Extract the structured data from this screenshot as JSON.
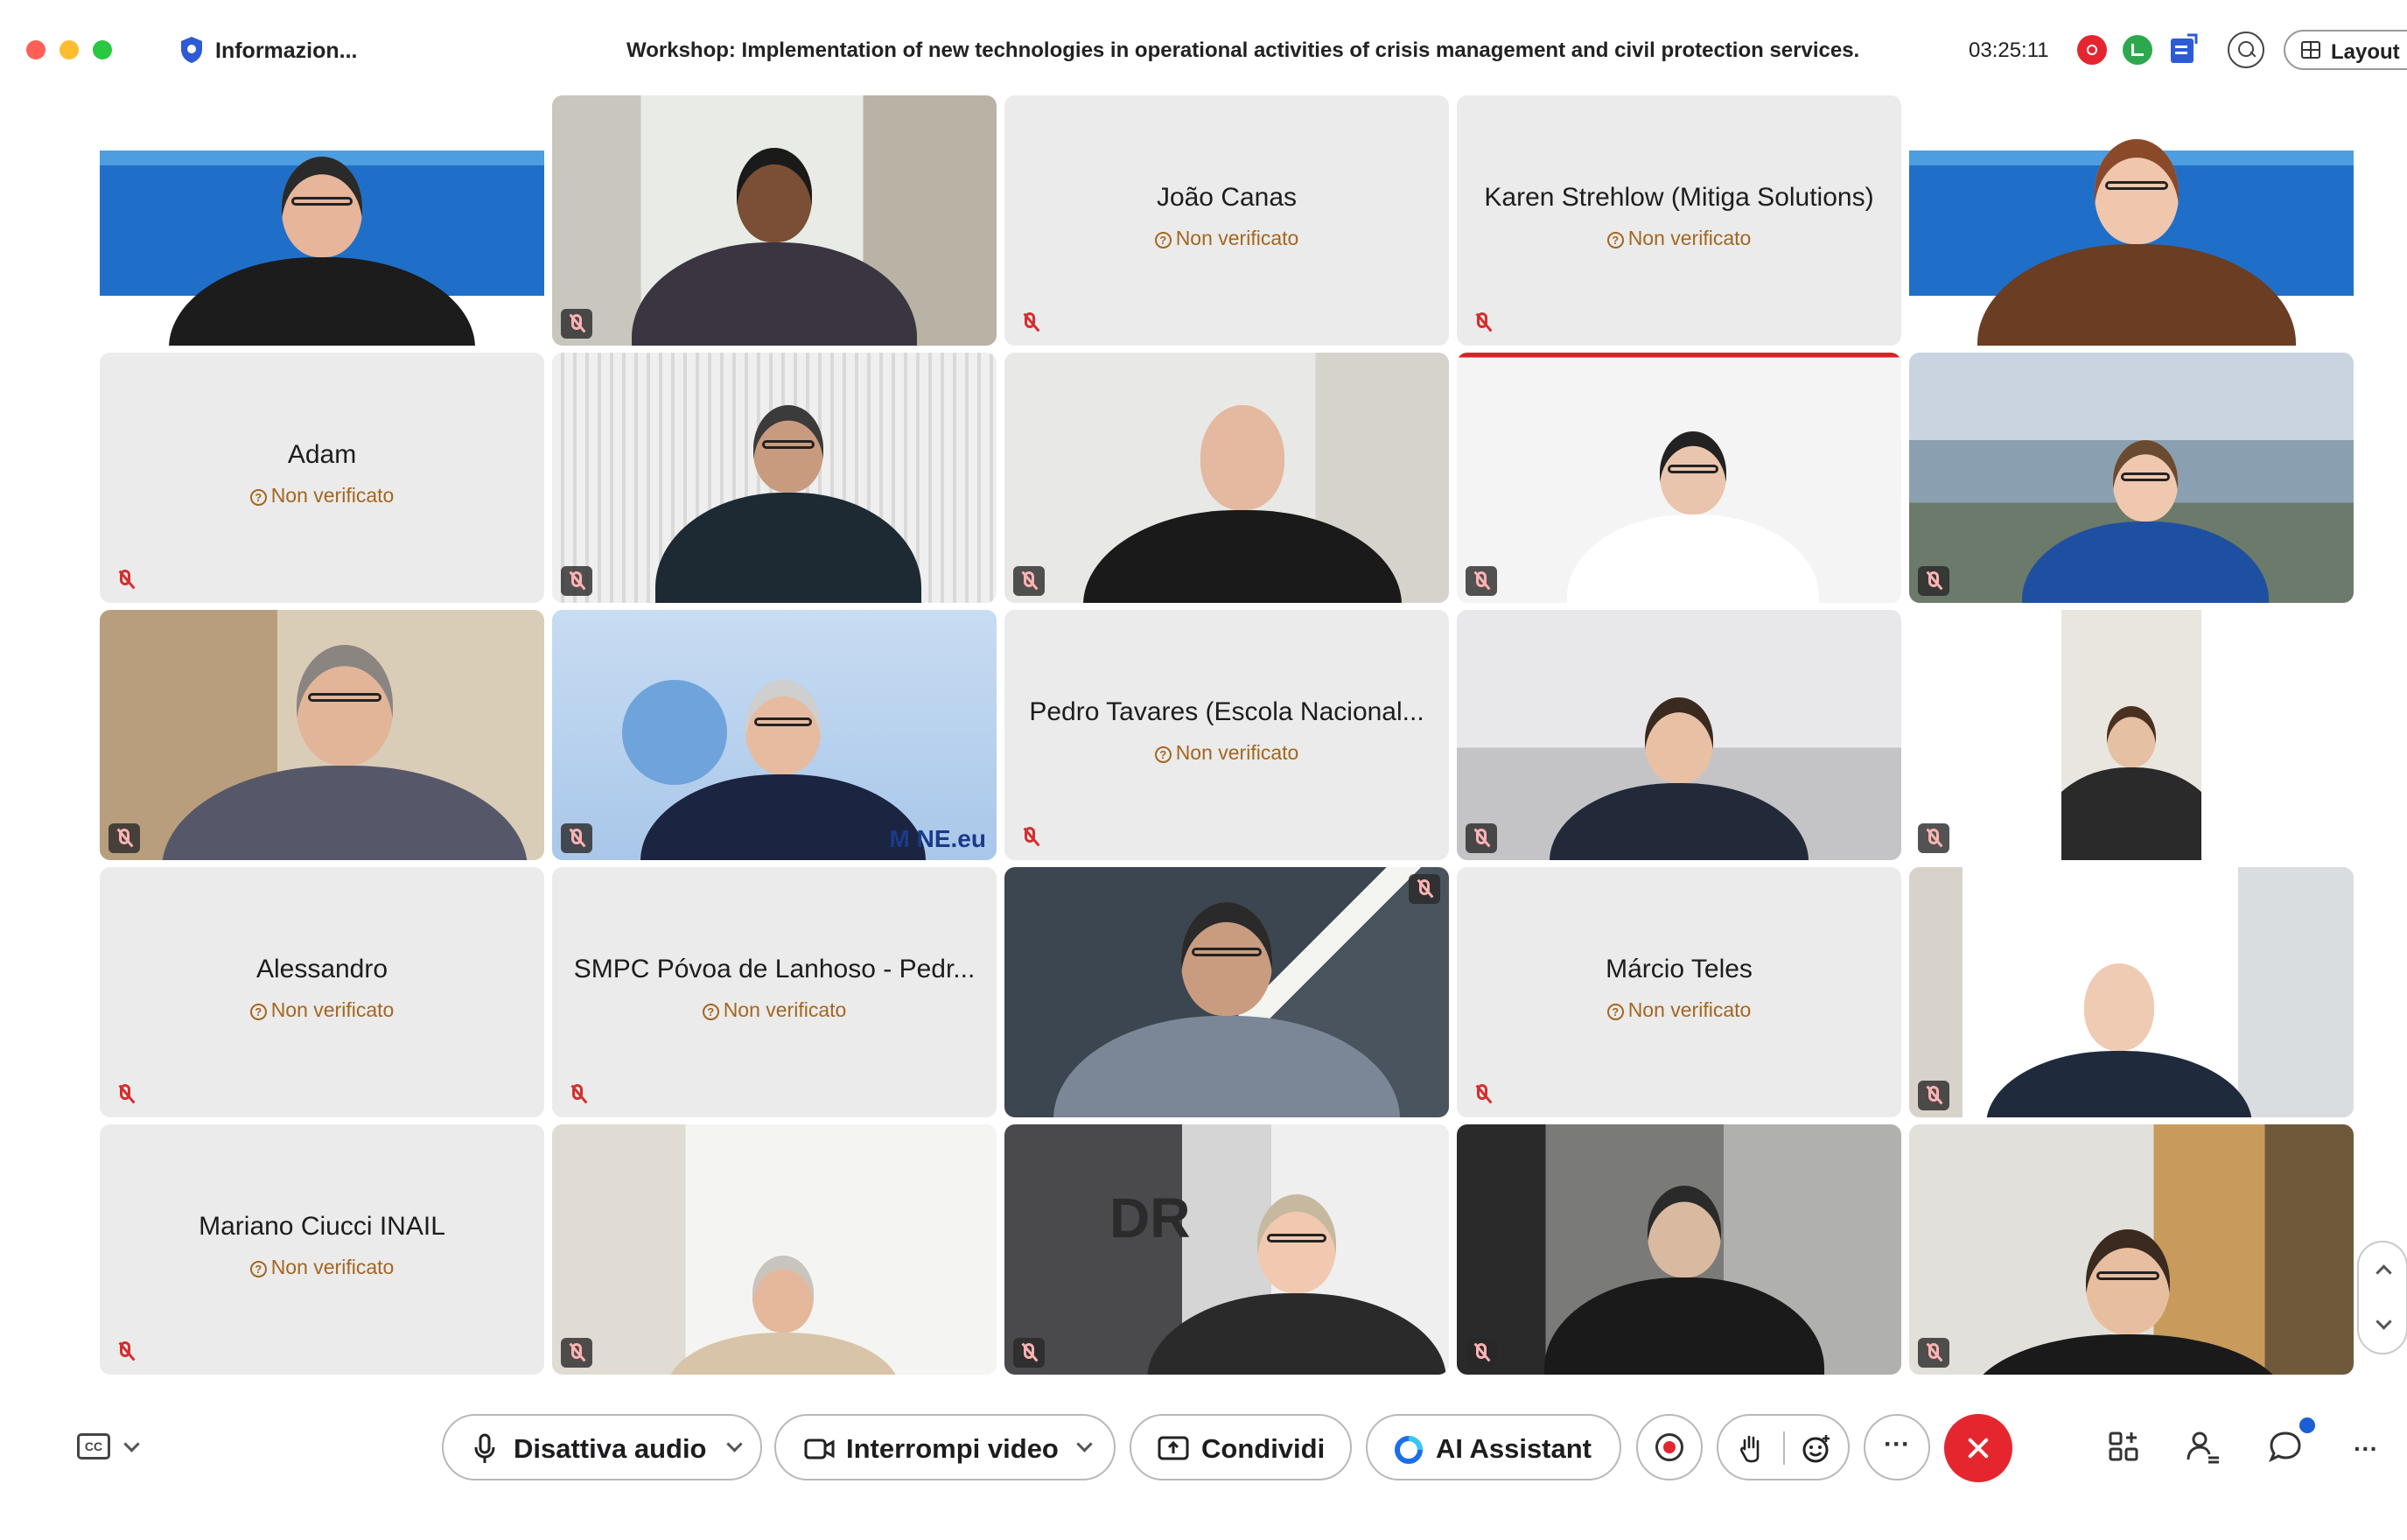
{
  "window": {
    "info_title": "Informazion...",
    "meeting_title": "Workshop: Implementation of new technologies in operational activities of crisis management and civil protection services.",
    "timer": "03:25:11",
    "layout_label": "Layout"
  },
  "tiles": [
    {
      "type": "video",
      "scene": "banner-left"
    },
    {
      "type": "video",
      "scene": "office-window"
    },
    {
      "type": "placeholder",
      "name": "João Canas",
      "status": "Non verificato"
    },
    {
      "type": "placeholder",
      "name": "Karen Strehlow (Mitiga Solutions)",
      "status": "Non verificato"
    },
    {
      "type": "video",
      "scene": "banner-right"
    },
    {
      "type": "placeholder",
      "name": "Adam",
      "status": "Non verificato"
    },
    {
      "type": "video",
      "scene": "blinds"
    },
    {
      "type": "video",
      "scene": "office-art"
    },
    {
      "type": "video",
      "scene": "red-cross"
    },
    {
      "type": "video",
      "scene": "mountain"
    },
    {
      "type": "video",
      "scene": "kitchen"
    },
    {
      "type": "video",
      "scene": "mine-logo",
      "overlay_text": "M NE.eu"
    },
    {
      "type": "placeholder",
      "name": "Pedro Tavares (Escola Nacional...",
      "status": "Non verificato"
    },
    {
      "type": "video",
      "scene": "open-office"
    },
    {
      "type": "video",
      "scene": "portrait-narrow"
    },
    {
      "type": "placeholder",
      "name": "Alessandro",
      "status": "Non verificato"
    },
    {
      "type": "placeholder",
      "name": "SMPC Póvoa de Lanhoso - Pedr...",
      "status": "Non verificato"
    },
    {
      "type": "video",
      "scene": "headphones-dark"
    },
    {
      "type": "placeholder",
      "name": "Márcio Teles",
      "status": "Non verificato"
    },
    {
      "type": "video",
      "scene": "bookshelf"
    },
    {
      "type": "placeholder",
      "name": "Mariano Ciucci INAIL",
      "status": "Non verificato"
    },
    {
      "type": "video",
      "scene": "bright-office"
    },
    {
      "type": "video",
      "scene": "dri-office",
      "overlay_text": "DR"
    },
    {
      "type": "video",
      "scene": "dim-room"
    },
    {
      "type": "video",
      "scene": "painting-wall"
    }
  ],
  "controls": {
    "mute_label": "Disattiva audio",
    "video_label": "Interrompi video",
    "share_label": "Condividi",
    "ai_label": "AI Assistant",
    "more_label": "···"
  },
  "icons": {
    "captions": "cc-icon",
    "mic": "microphone-icon",
    "camera": "camera-icon",
    "share": "share-screen-icon",
    "ai": "ai-assistant-icon",
    "record": "record-icon",
    "raise_hand": "raise-hand-icon",
    "reactions": "reactions-icon",
    "end": "end-call-icon",
    "apps": "apps-icon",
    "participants": "participants-icon",
    "chat": "chat-icon"
  },
  "colors": {
    "end_call": "#e5262e",
    "record": "#e3262f",
    "unverified": "#a4661f",
    "muted_mic": "#d32f2f"
  }
}
